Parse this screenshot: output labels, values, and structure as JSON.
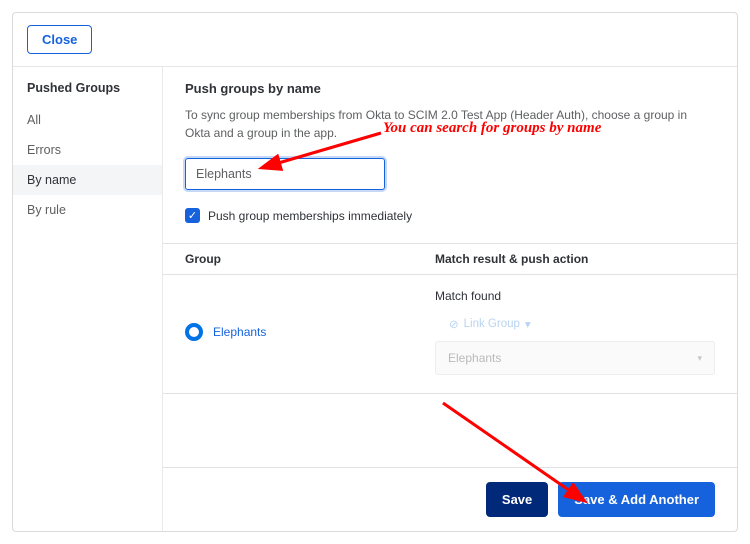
{
  "header": {
    "close": "Close"
  },
  "sidebar": {
    "title": "Pushed Groups",
    "items": [
      {
        "label": "All"
      },
      {
        "label": "Errors"
      },
      {
        "label": "By name"
      },
      {
        "label": "By rule"
      }
    ],
    "selected_index": 2
  },
  "main": {
    "title": "Push groups by name",
    "description": "To sync group memberships from Okta to SCIM 2.0 Test App (Header Auth), choose a group in Okta and a group in the app.",
    "search_value": "Elephants",
    "checkbox_label": "Push group memberships immediately",
    "checkbox_checked": true,
    "table": {
      "col_group": "Group",
      "col_action": "Match result & push action",
      "row": {
        "group_name": "Elephants",
        "match_text": "Match found",
        "link_group_text": "Link Group",
        "select_value": "Elephants"
      }
    }
  },
  "footer": {
    "save": "Save",
    "save_add": "Save & Add Another"
  },
  "annotations": {
    "a1": "You can search for groups by name"
  }
}
